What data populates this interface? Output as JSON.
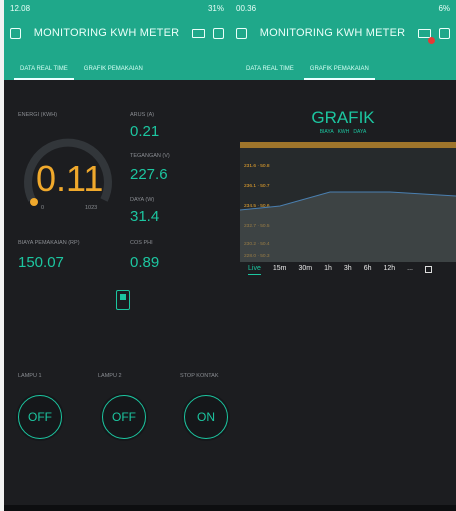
{
  "left": {
    "status": {
      "time": "12.08",
      "indicators": "31%"
    },
    "appbar": {
      "title": "MONITORING KWH METER"
    },
    "tabs": [
      {
        "label": "DATA REAL TIME"
      },
      {
        "label": "GRAFIK PEMAKAIAN"
      }
    ],
    "energi": {
      "label": "ENERGI (KWH)",
      "value": "0.11",
      "min": "0",
      "max": "1023"
    },
    "arus": {
      "label": "ARUS (A)",
      "value": "0.21"
    },
    "tegangan": {
      "label": "TEGANGAN (V)",
      "value": "227.6"
    },
    "daya": {
      "label": "DAYA (W)",
      "value": "31.4"
    },
    "biaya": {
      "label": "BIAYA PEMAKAIAN (RP)",
      "value": "150.07"
    },
    "cosphi": {
      "label": "COS PHI",
      "value": "0.89"
    },
    "controls": [
      {
        "label": "LAMPU 1",
        "state": "OFF"
      },
      {
        "label": "LAMPU 2",
        "state": "OFF"
      },
      {
        "label": "STOP KONTAK",
        "state": "ON"
      }
    ]
  },
  "right": {
    "status": {
      "time": "00.36",
      "indicators": "6%"
    },
    "appbar": {
      "title": "MONITORING KWH METER"
    },
    "tabs": [
      {
        "label": "DATA REAL TIME"
      },
      {
        "label": "GRAFIK PEMAKAIAN"
      }
    ],
    "chart_data": {
      "type": "line",
      "title": "GRAFIK",
      "series": [
        {
          "name": "BIAYA",
          "values": []
        },
        {
          "name": "KWH",
          "values": []
        },
        {
          "name": "DAYA",
          "values": []
        }
      ],
      "ylabels": [
        "231.6 · 50.8",
        "236.1 · 50.7",
        "234.5 · 50.6",
        "232.7 · 50.5",
        "230.2 · 50.4",
        "228.0 · 50.3"
      ],
      "time_ranges": [
        "Live",
        "15m",
        "30m",
        "1h",
        "3h",
        "6h",
        "12h",
        "..."
      ]
    }
  }
}
